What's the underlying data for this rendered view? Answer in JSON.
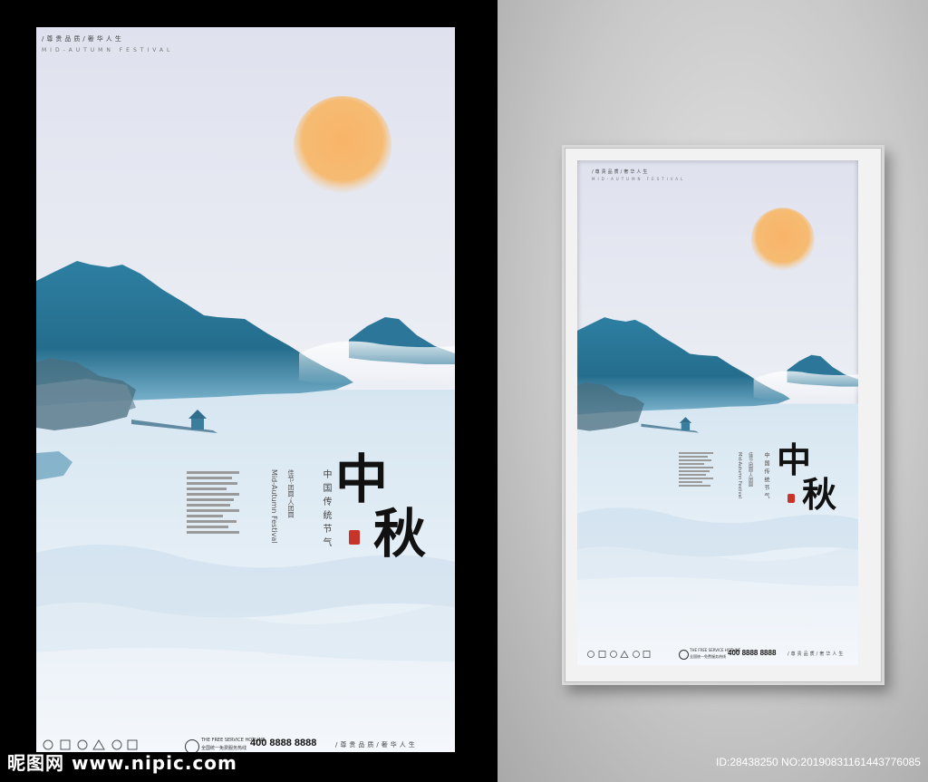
{
  "poster": {
    "tagline": "/尊贵品质/奢华人生",
    "festival_en": "MID-AUTUMN FESTIVAL",
    "title_chars": [
      "中",
      "秋"
    ],
    "vertical_en": "Mid-Autumn Festival",
    "vertical_cn_phrase": "中国传统节气",
    "vertical_cn_small": "佳节·团圆·人团圆",
    "hotline_en": "THE FREE SERVICE HOTLINE",
    "hotline_cn": "全国统一免费服务热线",
    "hotline_number": "400 8888 8888"
  },
  "colors": {
    "mountain": "#2f7d9e",
    "moon": "#f6b66a",
    "seal": "#c8332a"
  },
  "watermark": {
    "logo": "昵图网 www.nipic.com",
    "id": "ID:28438250 NO:20190831161443776085"
  }
}
